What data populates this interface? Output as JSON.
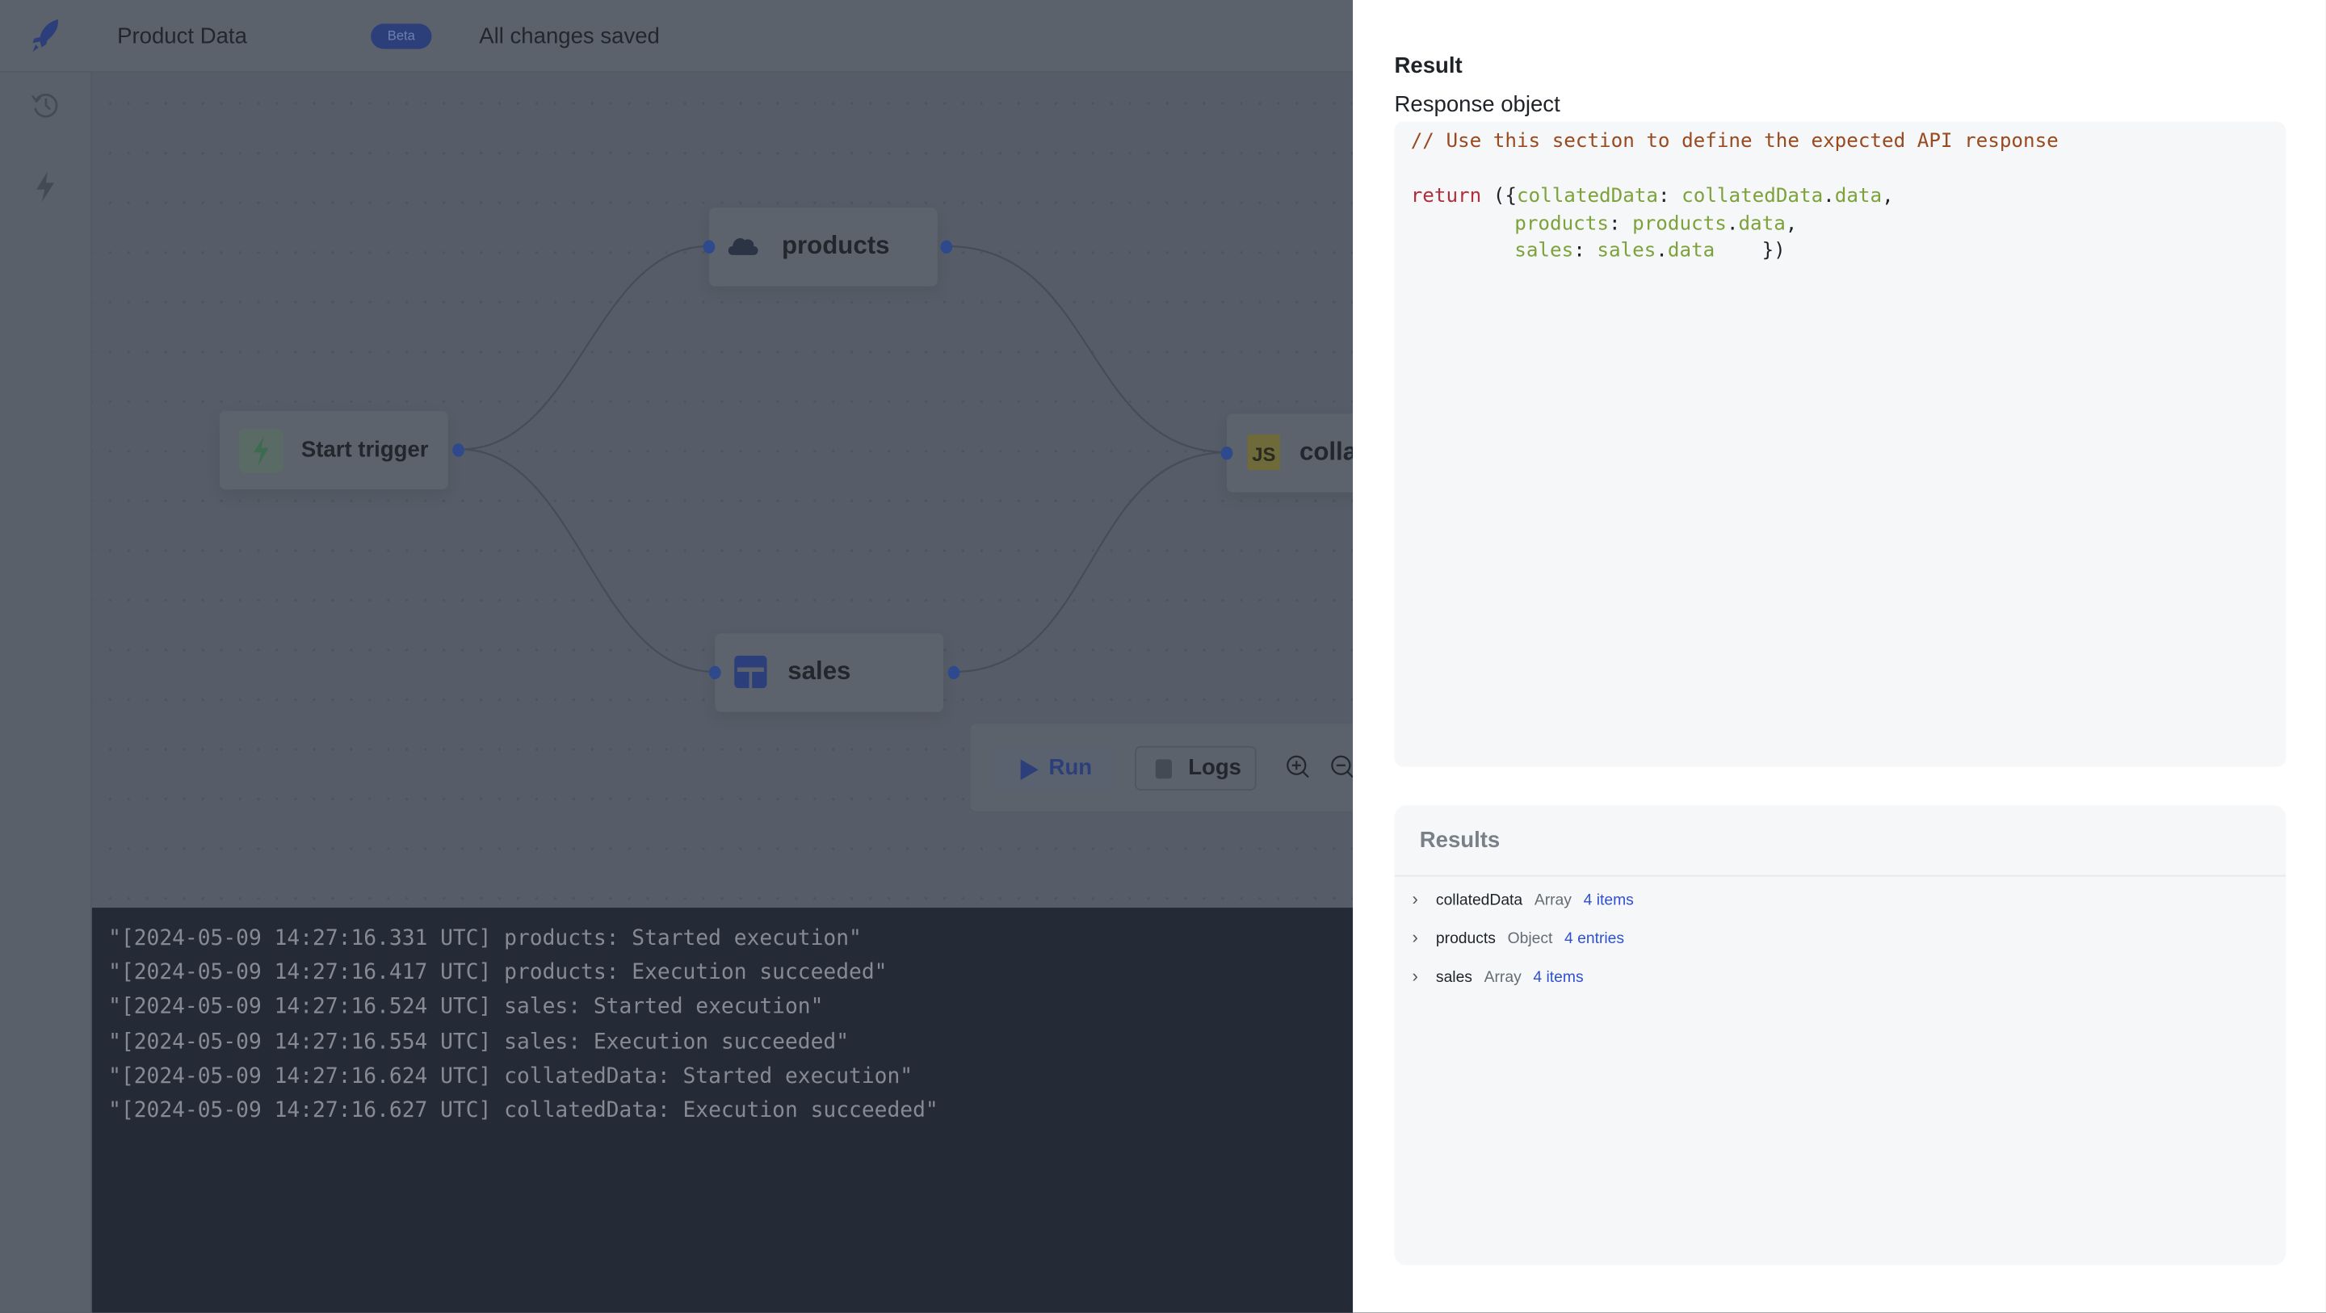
{
  "header": {
    "title": "Product Data",
    "badge": "Beta",
    "status": "All changes saved"
  },
  "sidebar": {
    "items": [
      {
        "icon": "history-icon"
      },
      {
        "icon": "lightning-icon"
      }
    ]
  },
  "nodes": {
    "products": "products",
    "start": "Start trigger",
    "sales": "sales",
    "collated": "colla",
    "products_icon": "REST",
    "collated_icon": "JS"
  },
  "toolbar": {
    "run": "Run",
    "logs": "Logs"
  },
  "logs": [
    "\"[2024-05-09 14:27:16.331 UTC] products: Started execution\"",
    "\"[2024-05-09 14:27:16.417 UTC] products: Execution succeeded\"",
    "\"[2024-05-09 14:27:16.524 UTC] sales: Started execution\"",
    "\"[2024-05-09 14:27:16.554 UTC] sales: Execution succeeded\"",
    "\"[2024-05-09 14:27:16.624 UTC] collatedData: Started execution\"",
    "\"[2024-05-09 14:27:16.627 UTC] collatedData: Execution succeeded\""
  ],
  "panel": {
    "heading": "Result",
    "subheading": "Response object",
    "code": {
      "comment": "// Use this section to define the expected API response",
      "kw": "return",
      "open": " ({",
      "k1": "collatedData",
      "v1": "collatedData",
      "k2": "products",
      "v2": "products",
      "k3": "sales",
      "v3": "sales",
      "prop": "data",
      "close": "    })"
    },
    "results_title": "Results",
    "results": [
      {
        "key": "collatedData",
        "type": "Array",
        "count": "4 items"
      },
      {
        "key": "products",
        "type": "Object",
        "count": "4 entries"
      },
      {
        "key": "sales",
        "type": "Array",
        "count": "4 items"
      }
    ]
  }
}
